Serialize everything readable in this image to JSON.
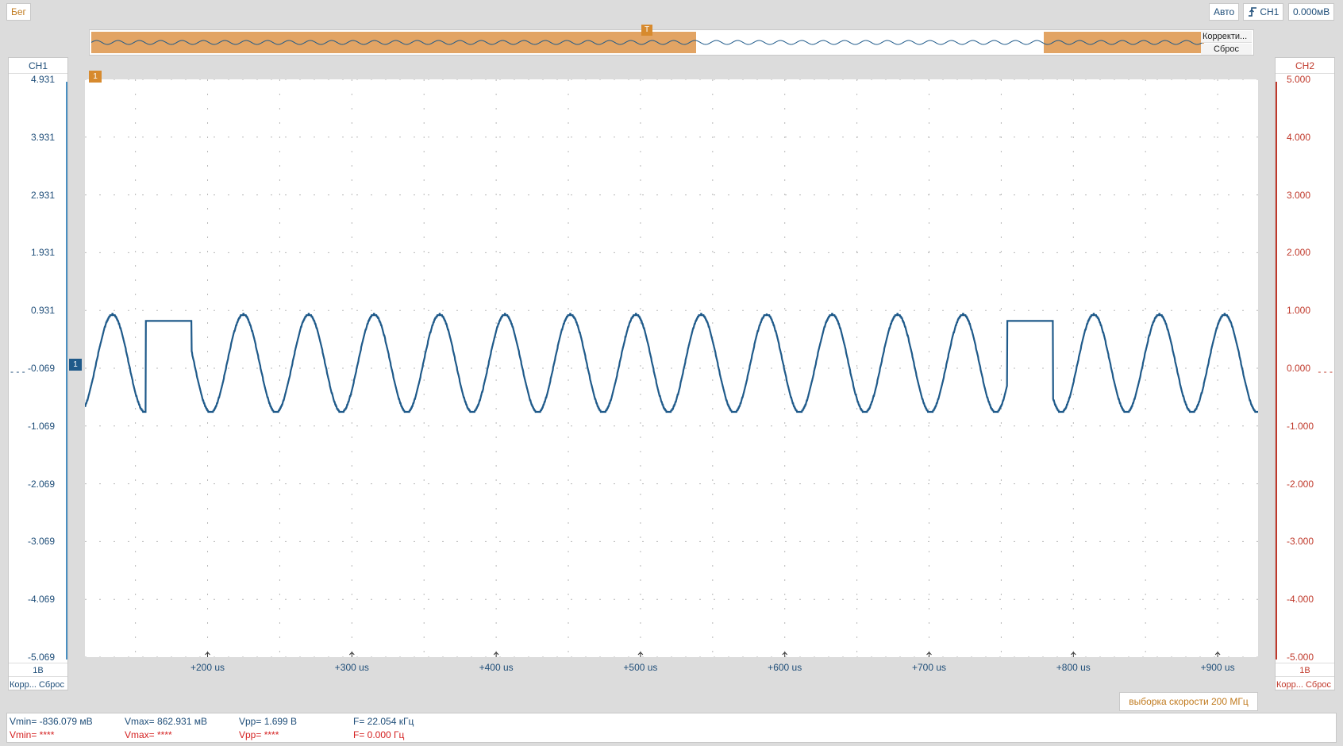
{
  "toolbar": {
    "run_label": "Бег",
    "mode_label": "Авто",
    "trigger_source": "CH1",
    "trigger_level": "0.000мВ"
  },
  "overview": {
    "correct_label": "Корректи...",
    "reset_label": "Сброс",
    "trigger_marker": "T"
  },
  "ch1": {
    "title": "CH1",
    "scale": "1В",
    "actions": "Корр... Сброс",
    "ticks": [
      "4.931",
      "3.931",
      "2.931",
      "1.931",
      "0.931",
      "-0.069",
      "-1.069",
      "-2.069",
      "-3.069",
      "-4.069",
      "-5.069"
    ],
    "offset_dash": "- - -",
    "color": "#1f5a8a"
  },
  "ch2": {
    "title": "CH2",
    "scale": "1В",
    "actions": "Корр... Сброс",
    "ticks": [
      "5.000",
      "4.000",
      "3.000",
      "2.000",
      "1.000",
      "0.000",
      "-1.000",
      "-2.000",
      "-3.000",
      "-4.000",
      "-5.000"
    ],
    "offset_dash": "- - -",
    "color": "#c0392b"
  },
  "markers": {
    "ch1_ref": "1",
    "time_ref": "1"
  },
  "sample_rate": "выборка скорости 200 МГц",
  "measurements": {
    "ch1": {
      "vmin": "Vmin= -836.079 мВ",
      "vmax": "Vmax= 862.931 мВ",
      "vpp": "Vpp= 1.699 В",
      "freq": "F= 22.054 кГц"
    },
    "ch2": {
      "vmin": "Vmin= ****",
      "vmax": "Vmax= ****",
      "vpp": "Vpp= ****",
      "freq": "F= 0.000 Гц"
    }
  },
  "chart_data": {
    "type": "line",
    "title": "",
    "xlabel": "",
    "ylabel": "",
    "x_ticks": [
      "+200 us",
      "+300 us",
      "+400 us",
      "+500 us",
      "+600 us",
      "+700 us",
      "+800 us",
      "+900 us"
    ],
    "xlim_us": [
      115,
      928
    ],
    "ylim": [
      -5.069,
      4.931
    ],
    "grid": true,
    "series": [
      {
        "name": "CH1",
        "color": "#1f5a8a",
        "waveform": "sine",
        "frequency_khz": 22.054,
        "vmin": -0.836,
        "vmax": 0.863,
        "flat_top_cycles_at_us": [
          173,
          770
        ]
      }
    ]
  }
}
